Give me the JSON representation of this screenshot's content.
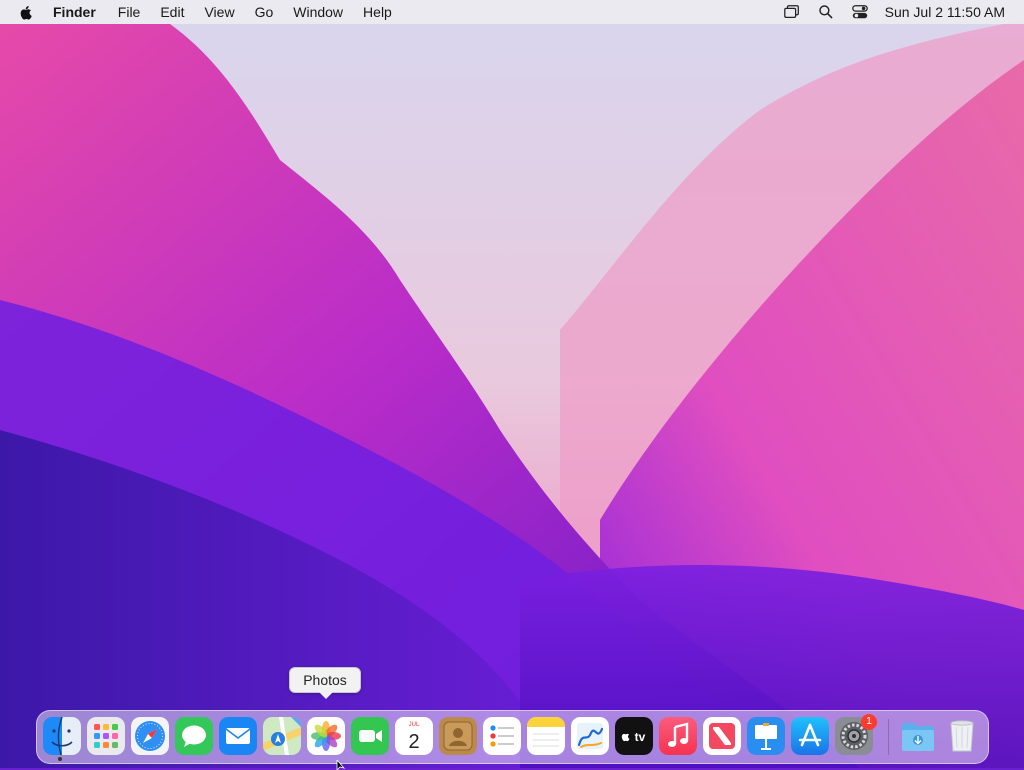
{
  "menubar": {
    "app_name": "Finder",
    "menus": [
      "File",
      "Edit",
      "View",
      "Go",
      "Window",
      "Help"
    ],
    "status_icons": [
      "screen-mirroring-icon",
      "spotlight-search-icon",
      "control-center-icon"
    ],
    "clock": "Sun Jul 2  11:50 AM"
  },
  "tooltip": {
    "text": "Photos"
  },
  "dock": {
    "apps": [
      {
        "name": "Finder",
        "icon": "finder-icon",
        "running": true
      },
      {
        "name": "Launchpad",
        "icon": "launchpad-icon"
      },
      {
        "name": "Safari",
        "icon": "safari-icon"
      },
      {
        "name": "Messages",
        "icon": "messages-icon"
      },
      {
        "name": "Mail",
        "icon": "mail-icon"
      },
      {
        "name": "Maps",
        "icon": "maps-icon"
      },
      {
        "name": "Photos",
        "icon": "photos-icon"
      },
      {
        "name": "FaceTime",
        "icon": "facetime-icon"
      },
      {
        "name": "Calendar",
        "icon": "calendar-icon",
        "month": "JUL",
        "day": "2"
      },
      {
        "name": "Contacts",
        "icon": "contacts-icon"
      },
      {
        "name": "Reminders",
        "icon": "reminders-icon"
      },
      {
        "name": "Notes",
        "icon": "notes-icon"
      },
      {
        "name": "Freeform",
        "icon": "freeform-icon"
      },
      {
        "name": "TV",
        "icon": "apple-tv-icon",
        "label": "tv"
      },
      {
        "name": "Music",
        "icon": "music-icon"
      },
      {
        "name": "News",
        "icon": "news-icon"
      },
      {
        "name": "Keynote",
        "icon": "keynote-icon"
      },
      {
        "name": "App Store",
        "icon": "app-store-icon"
      },
      {
        "name": "System Settings",
        "icon": "system-settings-icon",
        "badge": "1"
      }
    ],
    "stacks": [
      {
        "name": "Downloads",
        "icon": "downloads-folder-icon"
      },
      {
        "name": "Trash",
        "icon": "trash-icon"
      }
    ]
  },
  "colors": {
    "accent_blue": "#1d8af7",
    "badge_red": "#ff3b30"
  }
}
